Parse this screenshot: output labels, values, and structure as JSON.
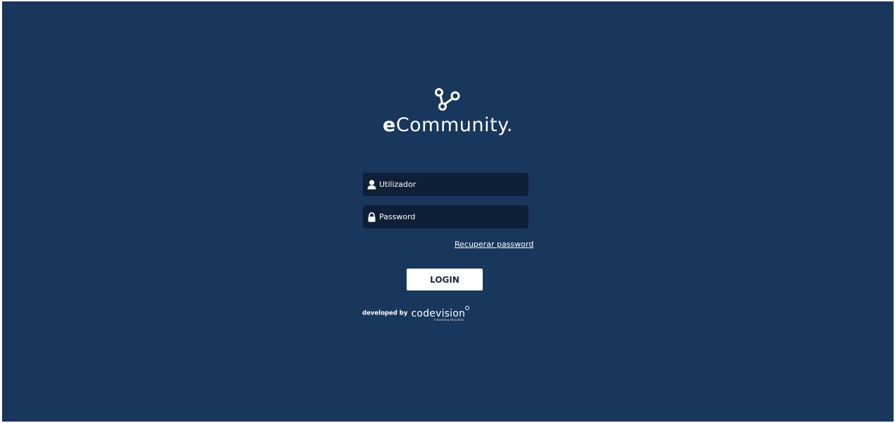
{
  "brand": {
    "logo_icon": "branch-nodes-icon",
    "name_prefix": "e",
    "name_rest": "Community."
  },
  "form": {
    "username_placeholder": "Utilizador",
    "username_icon": "user-icon",
    "password_placeholder": "Password",
    "password_icon": "lock-icon",
    "recover_link": "Recuperar password",
    "login_button": "LOGIN"
  },
  "footer": {
    "developed_by": "developed by",
    "developer_brand": "codevision",
    "developer_tagline": "innovating education"
  },
  "colors": {
    "background": "#19365c",
    "input_background": "#0e2038",
    "button_background": "#ffffff"
  }
}
